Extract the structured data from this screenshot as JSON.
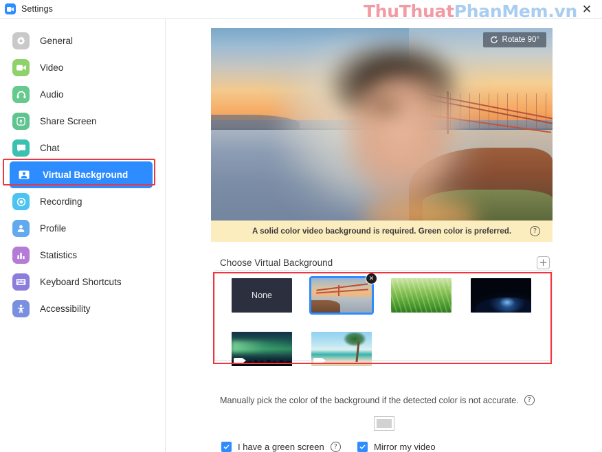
{
  "window": {
    "title": "Settings",
    "logo_icon": "zoom-video-icon",
    "close_icon": "close-icon"
  },
  "watermark": {
    "part1": "ThuThuat",
    "part2": "PhanMem.vn",
    "color1": "#f29ba5",
    "color2": "#a9cdf0"
  },
  "sidebar": {
    "items": [
      {
        "label": "General",
        "icon": "gear-icon",
        "color": "#c9c9c9",
        "active": false
      },
      {
        "label": "Video",
        "icon": "camera-icon",
        "color": "#8fd16b",
        "active": false
      },
      {
        "label": "Audio",
        "icon": "headphone-icon",
        "color": "#66c98e",
        "active": false
      },
      {
        "label": "Share Screen",
        "icon": "upload-icon",
        "color": "#5fc490",
        "active": false
      },
      {
        "label": "Chat",
        "icon": "chat-icon",
        "color": "#3cc0b0",
        "active": false
      },
      {
        "label": "Virtual Background",
        "icon": "person-card-icon",
        "color": "#2d8cff",
        "active": true
      },
      {
        "label": "Recording",
        "icon": "record-icon",
        "color": "#4cc3f0",
        "active": false
      },
      {
        "label": "Profile",
        "icon": "user-icon",
        "color": "#62aaf0",
        "active": false
      },
      {
        "label": "Statistics",
        "icon": "bar-chart-icon",
        "color": "#b47cd6",
        "active": false
      },
      {
        "label": "Keyboard Shortcuts",
        "icon": "keyboard-icon",
        "color": "#8a7ddc",
        "active": false
      },
      {
        "label": "Accessibility",
        "icon": "accessibility-icon",
        "color": "#7b8fe0",
        "active": false
      }
    ],
    "highlight_color": "#f5333f"
  },
  "preview": {
    "rotate_label": "Rotate 90°",
    "rotate_icon": "rotate-icon"
  },
  "notice": {
    "text": "A solid color video background is required. Green color is preferred.",
    "help_icon": "help-icon",
    "help_glyph": "?",
    "background": "#fcedbe"
  },
  "choose": {
    "label": "Choose Virtual Background",
    "add_icon": "plus-icon",
    "add_glyph": "+"
  },
  "thumbnails": [
    {
      "name": "None",
      "art": "none",
      "selected": false,
      "has_video_badge": false,
      "removable": false
    },
    {
      "name": "Golden Gate Bridge",
      "art": "bridge",
      "selected": true,
      "has_video_badge": false,
      "removable": true
    },
    {
      "name": "Green Grass",
      "art": "grass",
      "selected": false,
      "has_video_badge": false,
      "removable": false
    },
    {
      "name": "Earth from Space",
      "art": "space",
      "selected": false,
      "has_video_badge": false,
      "removable": false
    },
    {
      "name": "Aurora Forest",
      "art": "aurora",
      "selected": false,
      "has_video_badge": true,
      "removable": false
    },
    {
      "name": "Beach with Palm",
      "art": "beach",
      "selected": false,
      "has_video_badge": true,
      "removable": false
    }
  ],
  "thumbnail_labels": {
    "none_label": "None",
    "remove_glyph": "✕",
    "video_badge_icon": "video-badge-icon"
  },
  "manual": {
    "text": "Manually pick the color of the background if the detected color is not accurate.",
    "help_icon": "help-icon",
    "help_glyph": "?",
    "swatch_color": "#d2d2d2"
  },
  "checkboxes": [
    {
      "label": "I have a green screen",
      "checked": true,
      "has_help": true
    },
    {
      "label": "Mirror my video",
      "checked": true,
      "has_help": false
    }
  ],
  "accent_color": "#2d8cff"
}
